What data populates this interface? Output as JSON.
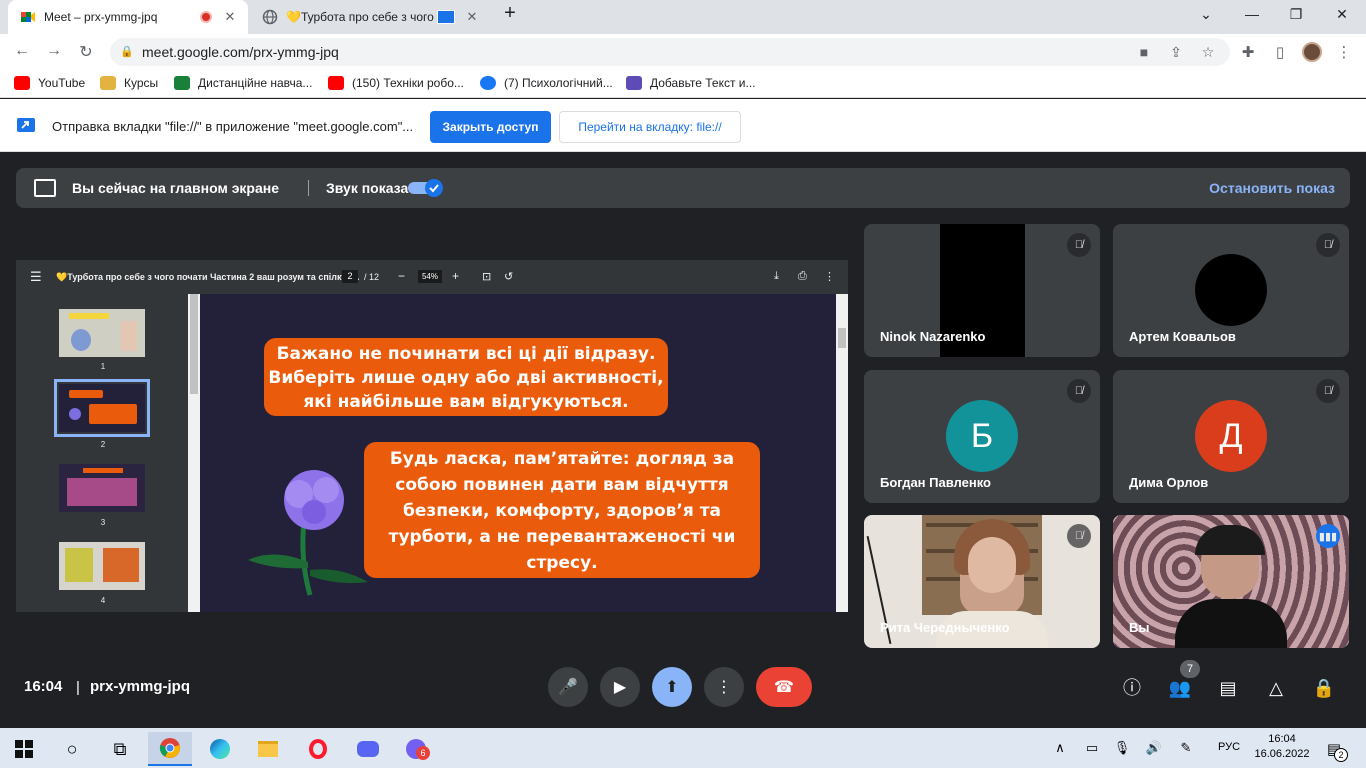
{
  "browser": {
    "tabs": [
      {
        "title": "Meet – prx-ymmg-jpq",
        "active": true
      },
      {
        "title": "💛Турбота про себе з чого",
        "active": false
      }
    ],
    "new_tab": "+",
    "url": "meet.google.com/prx-ymmg-jpq",
    "bookmarks": [
      {
        "label": "YouTube",
        "color": "#ff0000"
      },
      {
        "label": "Курсы",
        "color": "#e3b341"
      },
      {
        "label": "Дистанційне навча...",
        "color": "#188038"
      },
      {
        "label": "(150) Техніки робо...",
        "color": "#ff0000"
      },
      {
        "label": "(7) Психологічний...",
        "color": "#1877f2"
      },
      {
        "label": "Добавьте Текст и...",
        "color": "#5f4bb6"
      }
    ]
  },
  "infobar": {
    "message": "Отправка вкладки \"file://\" в приложение \"meet.google.com\"...",
    "close_access": "Закрыть доступ",
    "go_to_tab": "Перейти на вкладку: file://"
  },
  "presentation_bar": {
    "status": "Вы сейчас на главном экране",
    "sound_label": "Звук показа",
    "stop": "Остановить показ"
  },
  "pdf": {
    "title": "💛Турбота про себе з чого почати Частина 2 ваш розум та спілкув...",
    "page": "2",
    "pages": "/ 12",
    "zoom": "54%",
    "thumbnails": [
      "1",
      "2",
      "3",
      "4"
    ],
    "slide_text_1": "Бажано не починати всі ці дії відразу. Виберіть лише одну або дві активності, які найбільше вам відгукуються.",
    "slide_text_2": "Будь ласка, пам’ятайте: догляд за собою повинен дати вам відчуття безпеки, комфорту, здоров’я та турботи, а не перевантаженості чи стресу."
  },
  "participants": [
    {
      "name": "Ninok Nazarenko",
      "muted": true
    },
    {
      "name": "Артем Ковальов",
      "muted": true
    },
    {
      "name": "Богдан Павленко",
      "muted": true,
      "initial": "Б",
      "color": "#12939a"
    },
    {
      "name": "Дима Орлов",
      "muted": true,
      "initial": "Д",
      "color": "#d93d1c"
    },
    {
      "name": "Рита Чередныченко",
      "muted": true
    },
    {
      "name": "Вы",
      "muted": false
    }
  ],
  "meeting": {
    "time": "16:04",
    "code": "prx-ymmg-jpq",
    "people_count": "7"
  },
  "taskbar": {
    "lang": "РУС",
    "time": "16:04",
    "date": "16.06.2022",
    "notifications": "2",
    "viber_badge": "6"
  }
}
